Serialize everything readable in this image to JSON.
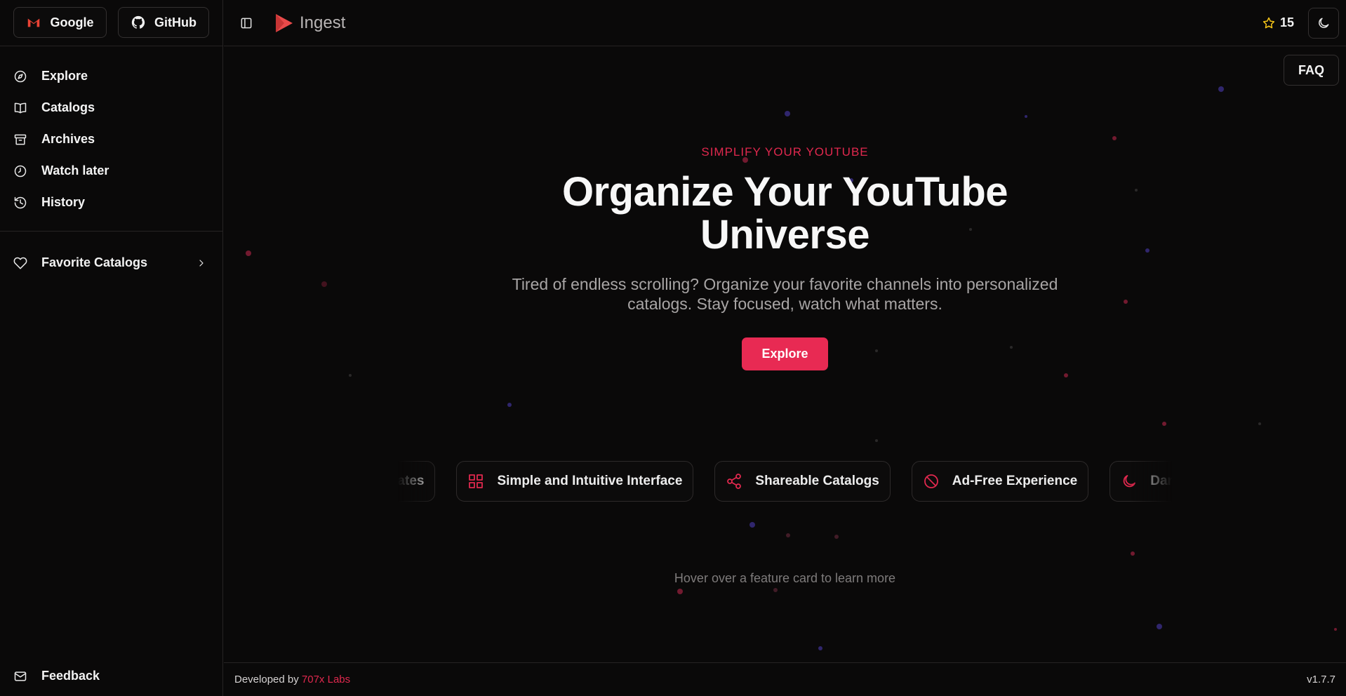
{
  "auth": {
    "google_label": "Google",
    "github_label": "GitHub"
  },
  "sidebar": {
    "items": [
      {
        "label": "Explore",
        "icon": "compass-icon"
      },
      {
        "label": "Catalogs",
        "icon": "book-icon"
      },
      {
        "label": "Archives",
        "icon": "archive-icon"
      },
      {
        "label": "Watch later",
        "icon": "clock-icon"
      },
      {
        "label": "History",
        "icon": "history-icon"
      }
    ],
    "favorites_label": "Favorite Catalogs",
    "feedback_label": "Feedback"
  },
  "header": {
    "brand": "Ingest",
    "stars": "15"
  },
  "main": {
    "faq_label": "FAQ",
    "kicker": "SIMPLIFY YOUR YOUTUBE",
    "headline_line1": "Organize Your YouTube",
    "headline_line2": "Universe",
    "subtitle": "Tired of endless scrolling? Organize your favorite channels into personalized catalogs. Stay focused, watch what matters.",
    "cta_label": "Explore",
    "features": [
      {
        "label": "Automated Updates",
        "icon": "refresh-icon"
      },
      {
        "label": "Simple and Intuitive Interface",
        "icon": "grid-icon"
      },
      {
        "label": "Shareable Catalogs",
        "icon": "share-icon"
      },
      {
        "label": "Ad-Free Experience",
        "icon": "ban-icon"
      },
      {
        "label": "Dark Mode",
        "icon": "moon-icon"
      }
    ],
    "hint": "Hover over a feature card to learn more"
  },
  "footer": {
    "developed_by": "Developed by",
    "lab_name": "707x Labs",
    "version": "v1.7.7"
  },
  "colors": {
    "accent": "#e82a53",
    "background": "#0a0909",
    "star": "#f5c518"
  }
}
